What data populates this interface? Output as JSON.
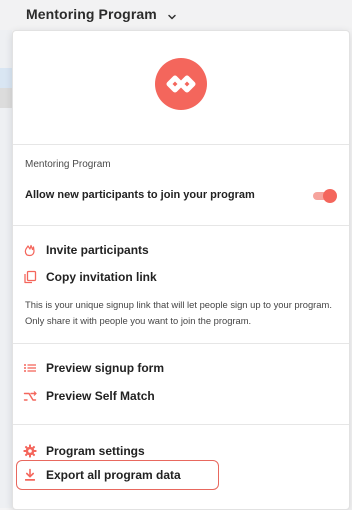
{
  "header": {
    "program_name": "Mentoring Program"
  },
  "menu": {
    "section_label": "Mentoring Program",
    "allow_new_participants_label": "Allow new participants to join your program",
    "allow_new_participants_enabled": true,
    "invite_label": "Invite participants",
    "copy_link_label": "Copy invitation link",
    "signup_link_description": "This is your unique signup link that will let people sign up to your program. Only share it with people you want to join the program.",
    "preview_signup_label": "Preview signup form",
    "preview_self_match_label": "Preview Self Match",
    "program_settings_label": "Program settings",
    "export_data_label": "Export all program data"
  },
  "colors": {
    "accent": "#f4665c",
    "accent_light": "#f6a49d",
    "text": "#222222"
  },
  "icons": {
    "logo": "infinity-link-logo",
    "invite": "waving-hand-icon",
    "copy": "copy-icon",
    "preview_signup": "list-icon",
    "preview_self_match": "match-arrows-icon",
    "settings": "gear-icon",
    "export": "download-icon",
    "switch": "chevron-down-icon"
  }
}
